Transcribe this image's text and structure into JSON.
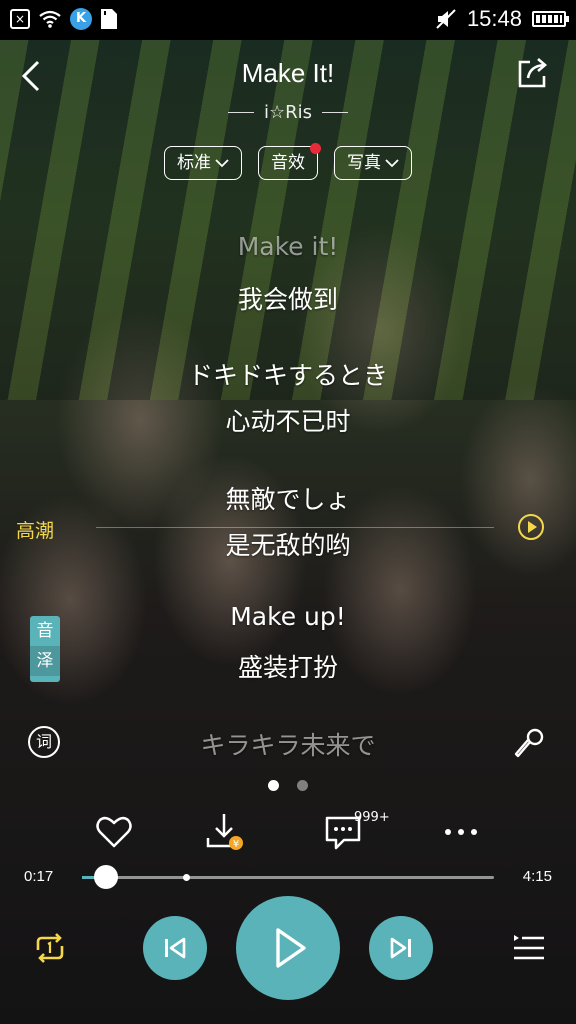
{
  "status_bar": {
    "time": "15:48",
    "app_badge": "K"
  },
  "header": {
    "title": "Make It!",
    "artist": "i☆Ris",
    "pills": {
      "quality": "标准",
      "effects": "音效",
      "photo": "写真"
    }
  },
  "lyrics": [
    {
      "text": "Make it!",
      "dim": true
    },
    {
      "text": "我会做到",
      "dim": false
    },
    {
      "text": "ドキドキするとき",
      "dim": false
    },
    {
      "text": "心动不已时",
      "dim": false
    },
    {
      "text": "無敵でしょ",
      "dim": false
    },
    {
      "text": "是无敌的哟",
      "dim": false
    },
    {
      "text": "Make up!",
      "dim": false
    },
    {
      "text": "盛装打扮",
      "dim": false
    },
    {
      "text": "キラキラ未来で",
      "dim": true
    }
  ],
  "climax": {
    "label": "高潮"
  },
  "translate": {
    "line1": "音",
    "line2": "泽"
  },
  "lyric_mode": {
    "label": "词"
  },
  "comments": {
    "count": "999+"
  },
  "progress": {
    "current": "0:17",
    "total": "4:15",
    "fraction": 0.067
  },
  "pager": {
    "pages": 2,
    "active": 0
  },
  "colors": {
    "accent": "#5ab3b8",
    "highlight": "#f5d84a",
    "badge_dot": "#e52d3a",
    "vip": "#f5a623"
  }
}
